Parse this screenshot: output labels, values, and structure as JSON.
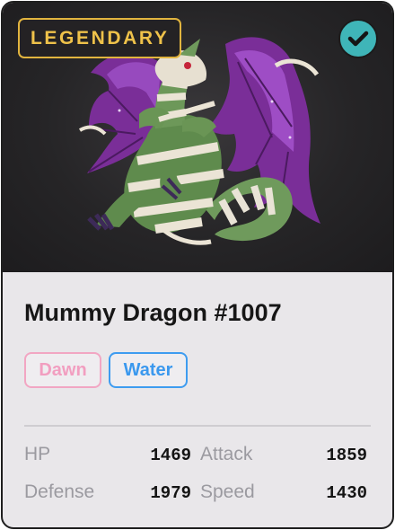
{
  "card": {
    "rarity": "LEGENDARY",
    "verified_icon": "checkmark-icon",
    "artwork": "mummy-dragon-artwork",
    "title": "Mummy Dragon #1007",
    "tags": [
      "Dawn",
      "Water"
    ],
    "stats": [
      {
        "label": "HP",
        "value": "1469"
      },
      {
        "label": "Attack",
        "value": "1859"
      },
      {
        "label": "Defense",
        "value": "1979"
      },
      {
        "label": "Speed",
        "value": "1430"
      }
    ]
  },
  "colors": {
    "rarity_gold": "#efc24a",
    "verified_teal": "#3fb5b8",
    "tag_dawn": "#f29ec0",
    "tag_water": "#3a98ee",
    "card_bg": "#e9e7ea",
    "art_bg": "#262527"
  }
}
